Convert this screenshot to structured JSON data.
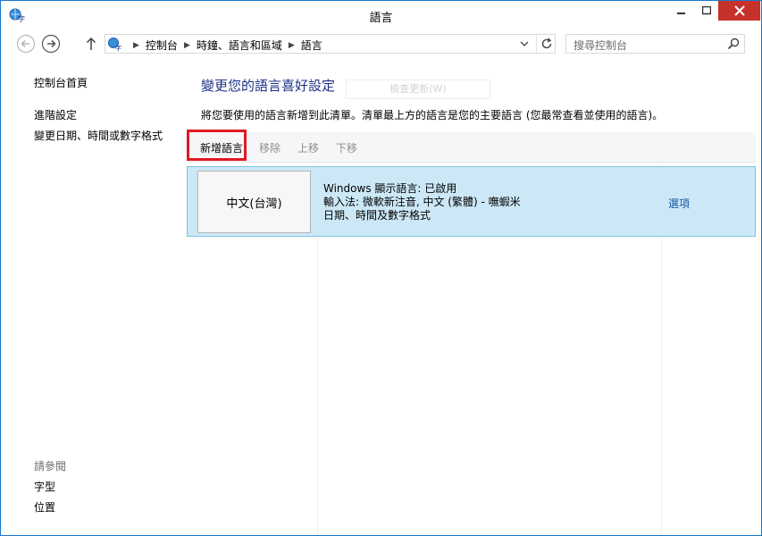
{
  "window": {
    "title": "語言"
  },
  "address_bar": {
    "breadcrumbs": [
      "控制台",
      "時鐘、語言和區域",
      "語言"
    ]
  },
  "search": {
    "placeholder": "搜尋控制台"
  },
  "sidebar": {
    "links": [
      "控制台首頁",
      "進階設定",
      "變更日期、時間或數字格式"
    ],
    "see_also_heading": "請參閱",
    "see_also_links": [
      "字型",
      "位置"
    ]
  },
  "main": {
    "title": "變更您的語言喜好設定",
    "ghost_button": "檢查更新(W)",
    "description": "將您要使用的語言新增到此清單。清單最上方的語言是您的主要語言 (您最常查看並使用的語言)。",
    "toolbar": {
      "add": "新增語言",
      "remove": "移除",
      "move_up": "上移",
      "move_down": "下移"
    },
    "languages": [
      {
        "name": "中文(台灣)",
        "details": [
          "Windows 顯示語言: 已啟用",
          "輸入法: 微軟新注音, 中文 (繁體) - 嘸蝦米",
          "日期、時間及數字格式"
        ],
        "options_label": "選項"
      }
    ]
  },
  "colors": {
    "title_blue": "#1e3287",
    "selected_row": "#cce8f6",
    "highlight_red": "#e01a22",
    "close_button": "#c7312b"
  }
}
